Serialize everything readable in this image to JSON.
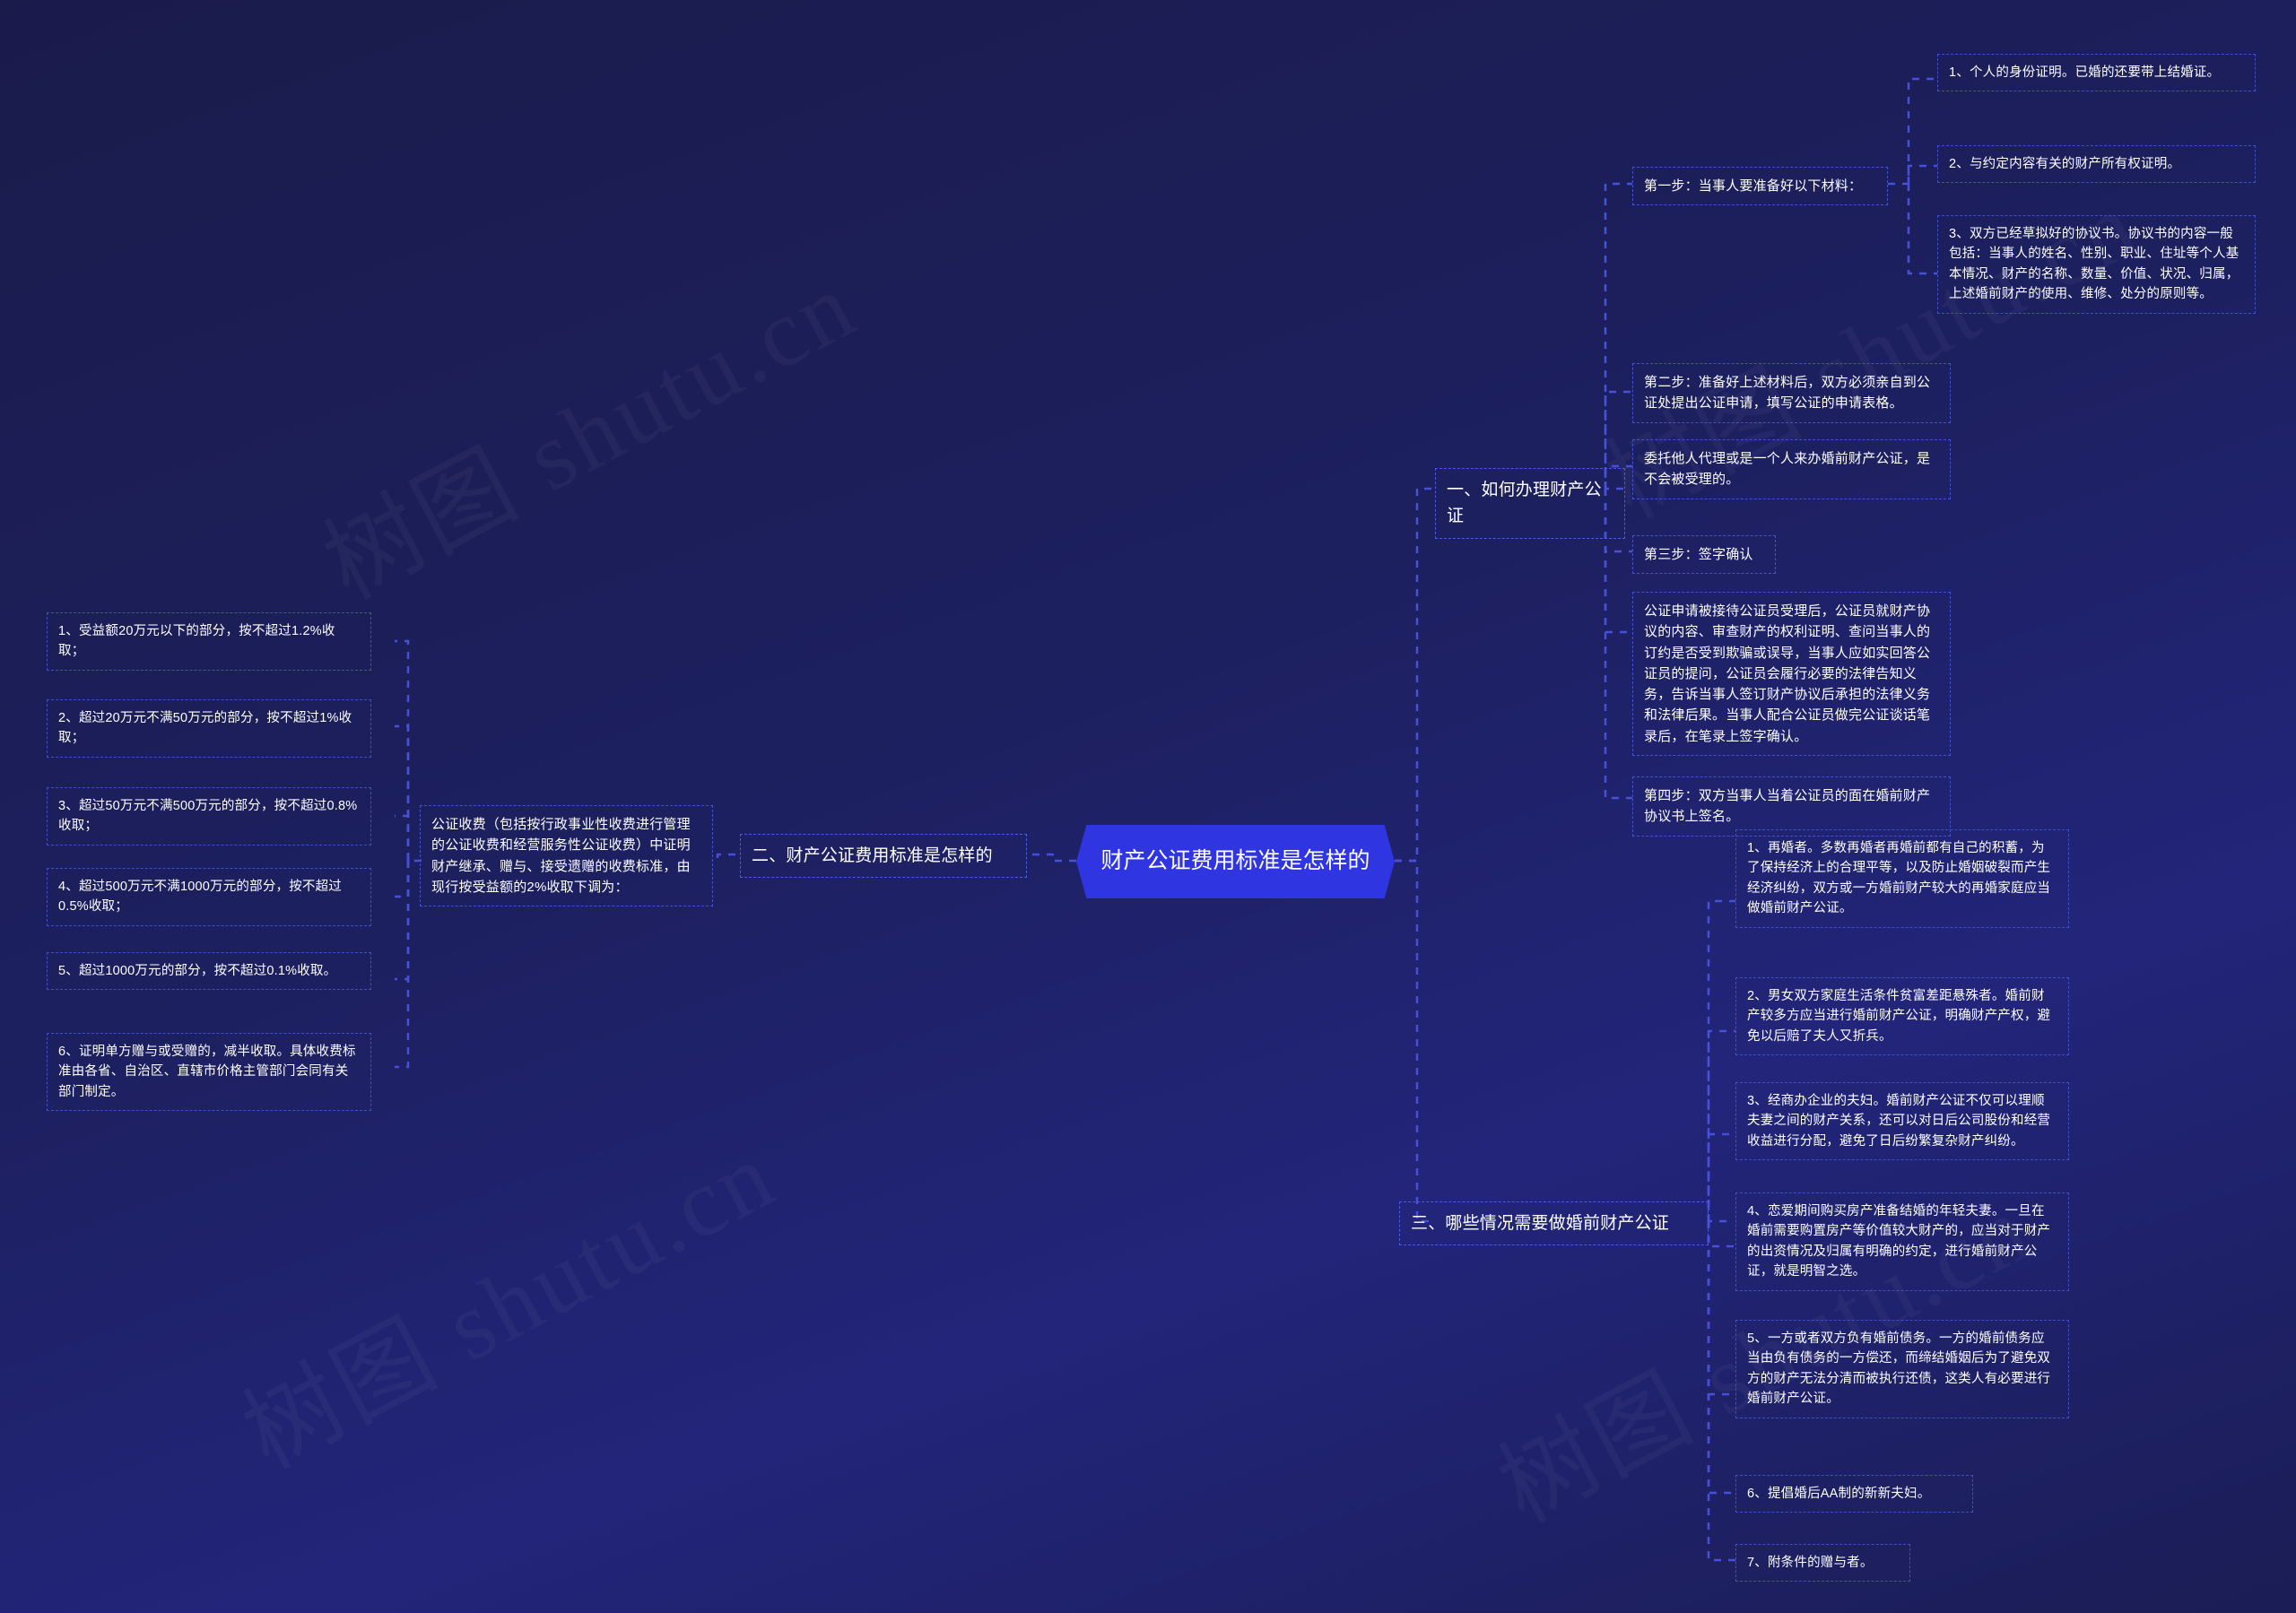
{
  "meta": {
    "background_color": "#1a1b4b",
    "accent_color": "#2f35e0",
    "node_border_color": "#4a55d8",
    "text_color": "#ffffff",
    "watermark_text": "树图 shutu.cn"
  },
  "root": {
    "label": "财产公证费用标准是怎样的"
  },
  "branches": [
    {
      "id": "branch-1",
      "label": "一、如何办理财产公证",
      "children": [
        {
          "label": "第一步：当事人要准备好以下材料：",
          "children": [
            {
              "label": "1、个人的身份证明。已婚的还要带上结婚证。"
            },
            {
              "label": "2、与约定内容有关的财产所有权证明。"
            },
            {
              "label": "3、双方已经草拟好的协议书。协议书的内容一般包括：当事人的姓名、性别、职业、住址等个人基本情况、财产的名称、数量、价值、状况、归属，上述婚前财产的使用、维修、处分的原则等。"
            }
          ]
        },
        {
          "label": "第二步：准备好上述材料后，双方必须亲自到公证处提出公证申请，填写公证的申请表格。",
          "children": []
        },
        {
          "label": "委托他人代理或是一个人来办婚前财产公证，是不会被受理的。",
          "children": []
        },
        {
          "label": "第三步：签字确认",
          "children": []
        },
        {
          "label": "公证申请被接待公证员受理后，公证员就财产协议的内容、审查财产的权利证明、查问当事人的订约是否受到欺骗或误导，当事人应如实回答公证员的提问，公证员会履行必要的法律告知义务，告诉当事人签订财产协议后承担的法律义务和法律后果。当事人配合公证员做完公证谈话笔录后，在笔录上签字确认。",
          "children": []
        },
        {
          "label": "第四步：双方当事人当着公证员的面在婚前财产协议书上签名。",
          "children": []
        }
      ]
    },
    {
      "id": "branch-2",
      "label": "二、财产公证费用标准是怎样的",
      "children": [
        {
          "label": "公证收费（包括按行政事业性收费进行管理的公证收费和经营服务性公证收费）中证明财产继承、赠与、接受遗赠的收费标准，由现行按受益额的2%收取下调为：",
          "children": [
            {
              "label": "1、受益额20万元以下的部分，按不超过1.2%收取；"
            },
            {
              "label": "2、超过20万元不满50万元的部分，按不超过1%收取；"
            },
            {
              "label": "3、超过50万元不满500万元的部分，按不超过0.8%收取；"
            },
            {
              "label": "4、超过500万元不满1000万元的部分，按不超过0.5%收取；"
            },
            {
              "label": "5、超过1000万元的部分，按不超过0.1%收取。"
            },
            {
              "label": "6、证明单方赠与或受赠的，减半收取。具体收费标准由各省、自治区、直辖市价格主管部门会同有关部门制定。"
            }
          ]
        }
      ]
    },
    {
      "id": "branch-3",
      "label": "三、哪些情况需要做婚前财产公证",
      "children": [
        {
          "label": "1、再婚者。多数再婚者再婚前都有自己的积蓄，为了保持经济上的合理平等，以及防止婚姻破裂而产生经济纠纷，双方或一方婚前财产较大的再婚家庭应当做婚前财产公证。"
        },
        {
          "label": "2、男女双方家庭生活条件贫富差距悬殊者。婚前财产较多方应当进行婚前财产公证，明确财产产权，避免以后赔了夫人又折兵。"
        },
        {
          "label": "3、经商办企业的夫妇。婚前财产公证不仅可以理顺夫妻之间的财产关系，还可以对日后公司股份和经营收益进行分配，避免了日后纷繁复杂财产纠纷。"
        },
        {
          "label": "4、恋爱期间购买房产准备结婚的年轻夫妻。一旦在婚前需要购置房产等价值较大财产的，应当对于财产的出资情况及归属有明确的约定，进行婚前财产公证，就是明智之选。"
        },
        {
          "label": "5、一方或者双方负有婚前债务。一方的婚前债务应当由负有债务的一方偿还，而缔结婚姻后为了避免双方的财产无法分清而被执行还债，这类人有必要进行婚前财产公证。"
        },
        {
          "label": "6、提倡婚后AA制的新新夫妇。"
        },
        {
          "label": "7、附条件的赠与者。"
        }
      ]
    }
  ]
}
